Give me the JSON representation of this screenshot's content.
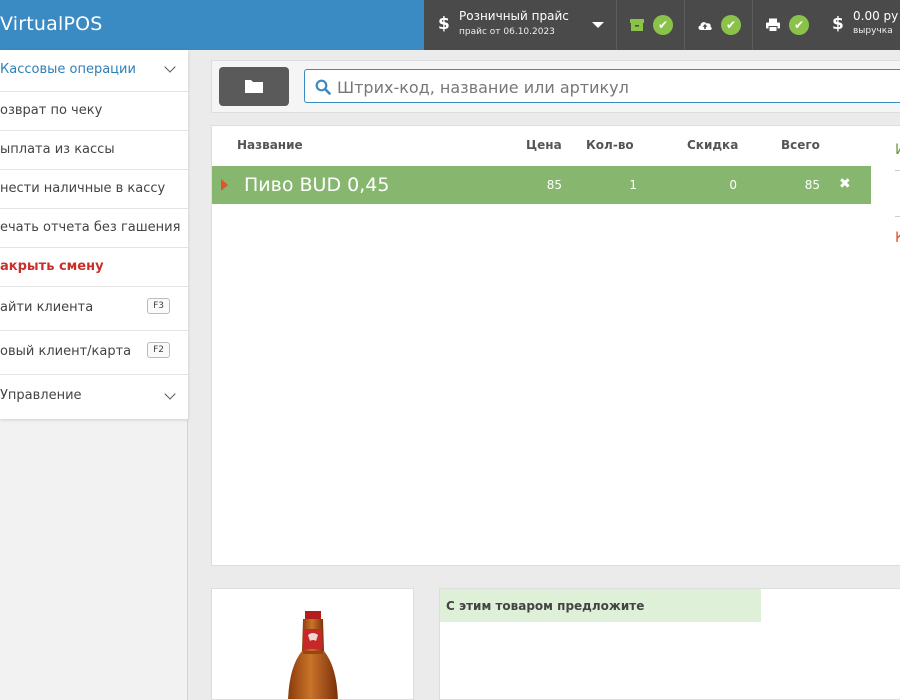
{
  "app": {
    "title": "VirtualPOS"
  },
  "topbar": {
    "price": {
      "title": "Розничный прайс",
      "subtitle": "прайс от 06.10.2023"
    },
    "cash": {
      "amount": "0.00 ру",
      "label": "выручка"
    },
    "statuses": [
      {
        "icon": "archive-icon"
      },
      {
        "icon": "cloud-upload-icon"
      },
      {
        "icon": "printer-icon"
      }
    ]
  },
  "sidebar": {
    "items": [
      {
        "label": "Кассовые операции",
        "kind": "header"
      },
      {
        "label": "озврат по чеку"
      },
      {
        "label": "ыплата из кассы"
      },
      {
        "label": "нести наличные в кассу"
      },
      {
        "label": "ечать отчета без гашения"
      },
      {
        "label": "акрыть смену",
        "kind": "danger"
      },
      {
        "label": "айти клиента",
        "shortcut": "F3"
      },
      {
        "label": "овый клиент/карта",
        "shortcut": "F2"
      },
      {
        "label": "Управление",
        "kind": "header"
      }
    ]
  },
  "search": {
    "placeholder": "Штрих-код, название или артикул",
    "value": ""
  },
  "table": {
    "columns": {
      "name": "Название",
      "price": "Цена",
      "qty": "Кол-во",
      "discount": "Скидка",
      "total": "Всего"
    },
    "rows": [
      {
        "name": "Пиво BUD 0,45",
        "price": "85",
        "qty": "1",
        "discount": "0",
        "total": "85"
      }
    ]
  },
  "side": {
    "letter1": "И",
    "letter2": "К"
  },
  "suggestions": {
    "title": "С этим товаром предложите"
  },
  "colors": {
    "accent": "#3a8ac3",
    "row": "#87b66f",
    "danger": "#c9302c",
    "ok": "#8bc34a"
  }
}
